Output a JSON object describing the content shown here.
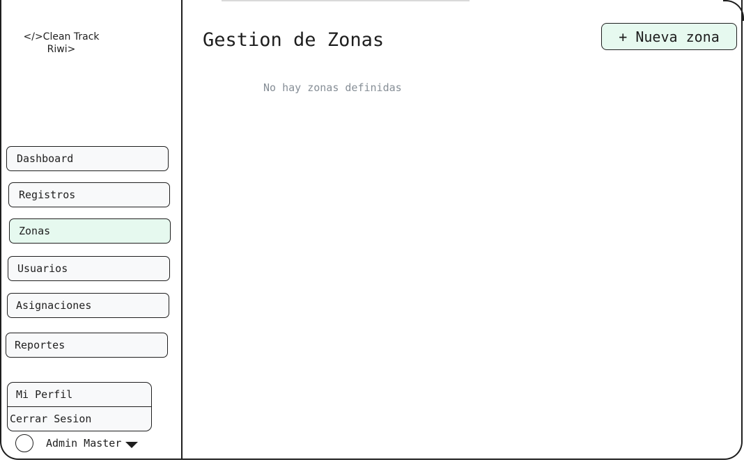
{
  "brand": {
    "line1": "</>Clean Track",
    "line2": "Riwi>"
  },
  "sidebar": {
    "items": [
      {
        "label": "Dashboard"
      },
      {
        "label": "Registros"
      },
      {
        "label": "Zonas"
      },
      {
        "label": "Usuarios"
      },
      {
        "label": "Asignaciones"
      },
      {
        "label": "Reportes"
      }
    ],
    "active": "Zonas"
  },
  "profile_menu": {
    "profile_label": "Mi Perfil",
    "logout_label": "Cerrar Sesion"
  },
  "user": {
    "name": "Admin Master"
  },
  "main": {
    "title": "Gestion de Zonas",
    "new_button_label": "+ Nueva zona",
    "empty_message": "No hay zonas definidas"
  },
  "colors": {
    "active_bg": "#e6f9ef",
    "item_bg": "#f8f9fa",
    "muted_text": "#868e96",
    "stroke": "#1e1e1e"
  }
}
